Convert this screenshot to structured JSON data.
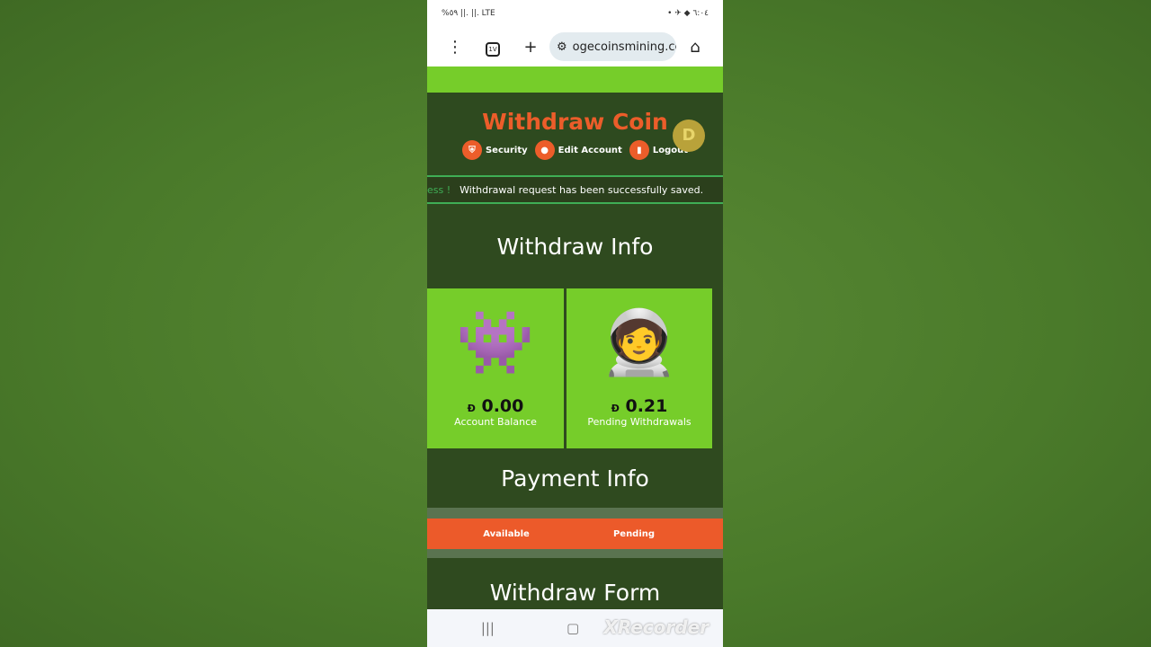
{
  "status_bar": {
    "left": "%٥٩ ||. ||. LTE",
    "right": "• ✈ ◆ ٦:٠٤"
  },
  "browser": {
    "url": "ogecoinsmining.com",
    "tab_count": "1V"
  },
  "header": {
    "title": "Withdraw Coin",
    "nav": [
      {
        "label": "Security",
        "icon": "shield-icon"
      },
      {
        "label": "Edit Account",
        "icon": "user-icon"
      },
      {
        "label": "Logout",
        "icon": "logout-icon"
      }
    ],
    "coin_letter": "D"
  },
  "alert": {
    "prefix": "ess !",
    "message": "Withdrawal request has been successfully saved."
  },
  "withdraw_info": {
    "title": "Withdraw Info",
    "cards": [
      {
        "currency": "Đ",
        "value": "0.00",
        "label": "Account Balance"
      },
      {
        "currency": "Đ",
        "value": "0.21",
        "label": "Pending Withdrawals"
      }
    ]
  },
  "payment_info": {
    "title": "Payment Info",
    "tabs": [
      "Available",
      "Pending"
    ]
  },
  "withdraw_form": {
    "title": "Withdraw Form"
  },
  "watermark": "XRecorder",
  "colors": {
    "accent": "#ec5d2a",
    "green": "#76cd2a",
    "dark": "#2e4a1f"
  }
}
